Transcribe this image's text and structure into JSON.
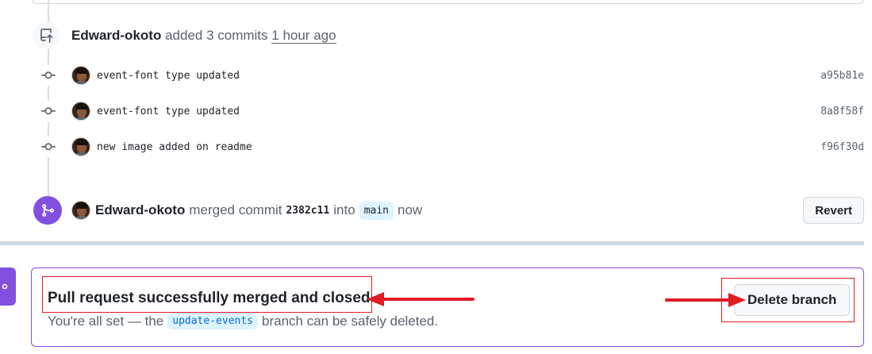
{
  "push_event": {
    "author": "Edward-okoto",
    "action": "added 3 commits",
    "time": "1 hour ago",
    "icon": "repo-push-icon"
  },
  "commits": [
    {
      "message": "event-font type updated",
      "sha": "a95b81e"
    },
    {
      "message": "event-font type updated",
      "sha": "8a8f58f"
    },
    {
      "message": "new image added on readme",
      "sha": "f96f30d"
    }
  ],
  "merge_event": {
    "author": "Edward-okoto",
    "action": "merged commit",
    "sha": "2382c11",
    "into": "into",
    "branch": "main",
    "time": "now",
    "revert_label": "Revert",
    "icon": "git-merge-icon"
  },
  "merged_box": {
    "title": "Pull request successfully merged and closed",
    "desc_before": "You're all set — the",
    "branch": "update-events",
    "desc_after": "branch can be safely deleted.",
    "delete_label": "Delete branch"
  },
  "colors": {
    "merge_purple": "#8250df",
    "annotation_red": "#e01b24",
    "branch_blue": "#0969da"
  }
}
